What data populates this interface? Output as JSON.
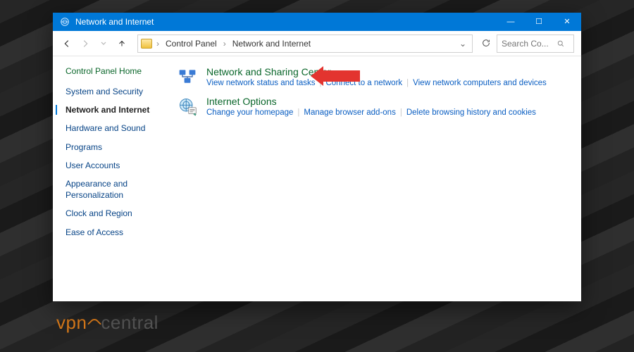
{
  "window": {
    "title": "Network and Internet"
  },
  "titlebar_buttons": {
    "min": "—",
    "max": "☐",
    "close": "✕"
  },
  "breadcrumb": {
    "root": "Control Panel",
    "current": "Network and Internet"
  },
  "search": {
    "placeholder": "Search Co..."
  },
  "sidebar": {
    "header": "Control Panel Home",
    "items": [
      {
        "label": "System and Security",
        "active": false
      },
      {
        "label": "Network and Internet",
        "active": true
      },
      {
        "label": "Hardware and Sound",
        "active": false
      },
      {
        "label": "Programs",
        "active": false
      },
      {
        "label": "User Accounts",
        "active": false
      },
      {
        "label": "Appearance and Personalization",
        "active": false
      },
      {
        "label": "Clock and Region",
        "active": false
      },
      {
        "label": "Ease of Access",
        "active": false
      }
    ]
  },
  "main": {
    "items": [
      {
        "id": "network-sharing-center",
        "title": "Network and Sharing Center",
        "links": [
          "View network status and tasks",
          "Connect to a network",
          "View network computers and devices"
        ],
        "callout": true
      },
      {
        "id": "internet-options",
        "title": "Internet Options",
        "links": [
          "Change your homepage",
          "Manage browser add-ons",
          "Delete browsing history and cookies"
        ],
        "callout": false
      }
    ]
  },
  "watermark": {
    "prefix": "vpn",
    "suffix": "central"
  }
}
